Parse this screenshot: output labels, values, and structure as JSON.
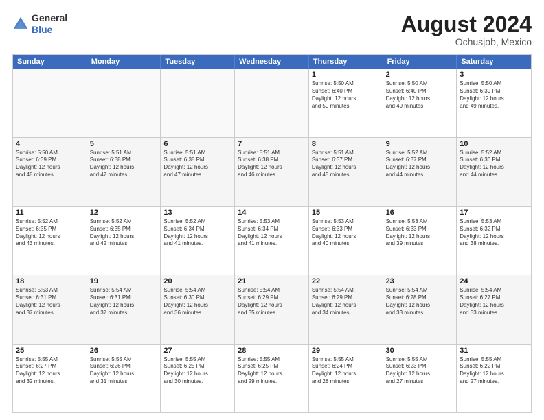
{
  "logo": {
    "text_general": "General",
    "text_blue": "Blue"
  },
  "header": {
    "month": "August 2024",
    "location": "Ochusjob, Mexico"
  },
  "weekdays": [
    "Sunday",
    "Monday",
    "Tuesday",
    "Wednesday",
    "Thursday",
    "Friday",
    "Saturday"
  ],
  "rows": [
    [
      {
        "day": "",
        "info": "",
        "empty": true
      },
      {
        "day": "",
        "info": "",
        "empty": true
      },
      {
        "day": "",
        "info": "",
        "empty": true
      },
      {
        "day": "",
        "info": "",
        "empty": true
      },
      {
        "day": "1",
        "info": "Sunrise: 5:50 AM\nSunset: 6:40 PM\nDaylight: 12 hours\nand 50 minutes.",
        "empty": false
      },
      {
        "day": "2",
        "info": "Sunrise: 5:50 AM\nSunset: 6:40 PM\nDaylight: 12 hours\nand 49 minutes.",
        "empty": false
      },
      {
        "day": "3",
        "info": "Sunrise: 5:50 AM\nSunset: 6:39 PM\nDaylight: 12 hours\nand 49 minutes.",
        "empty": false
      }
    ],
    [
      {
        "day": "4",
        "info": "Sunrise: 5:50 AM\nSunset: 6:39 PM\nDaylight: 12 hours\nand 48 minutes.",
        "empty": false
      },
      {
        "day": "5",
        "info": "Sunrise: 5:51 AM\nSunset: 6:38 PM\nDaylight: 12 hours\nand 47 minutes.",
        "empty": false
      },
      {
        "day": "6",
        "info": "Sunrise: 5:51 AM\nSunset: 6:38 PM\nDaylight: 12 hours\nand 47 minutes.",
        "empty": false
      },
      {
        "day": "7",
        "info": "Sunrise: 5:51 AM\nSunset: 6:38 PM\nDaylight: 12 hours\nand 46 minutes.",
        "empty": false
      },
      {
        "day": "8",
        "info": "Sunrise: 5:51 AM\nSunset: 6:37 PM\nDaylight: 12 hours\nand 45 minutes.",
        "empty": false
      },
      {
        "day": "9",
        "info": "Sunrise: 5:52 AM\nSunset: 6:37 PM\nDaylight: 12 hours\nand 44 minutes.",
        "empty": false
      },
      {
        "day": "10",
        "info": "Sunrise: 5:52 AM\nSunset: 6:36 PM\nDaylight: 12 hours\nand 44 minutes.",
        "empty": false
      }
    ],
    [
      {
        "day": "11",
        "info": "Sunrise: 5:52 AM\nSunset: 6:35 PM\nDaylight: 12 hours\nand 43 minutes.",
        "empty": false
      },
      {
        "day": "12",
        "info": "Sunrise: 5:52 AM\nSunset: 6:35 PM\nDaylight: 12 hours\nand 42 minutes.",
        "empty": false
      },
      {
        "day": "13",
        "info": "Sunrise: 5:52 AM\nSunset: 6:34 PM\nDaylight: 12 hours\nand 41 minutes.",
        "empty": false
      },
      {
        "day": "14",
        "info": "Sunrise: 5:53 AM\nSunset: 6:34 PM\nDaylight: 12 hours\nand 41 minutes.",
        "empty": false
      },
      {
        "day": "15",
        "info": "Sunrise: 5:53 AM\nSunset: 6:33 PM\nDaylight: 12 hours\nand 40 minutes.",
        "empty": false
      },
      {
        "day": "16",
        "info": "Sunrise: 5:53 AM\nSunset: 6:33 PM\nDaylight: 12 hours\nand 39 minutes.",
        "empty": false
      },
      {
        "day": "17",
        "info": "Sunrise: 5:53 AM\nSunset: 6:32 PM\nDaylight: 12 hours\nand 38 minutes.",
        "empty": false
      }
    ],
    [
      {
        "day": "18",
        "info": "Sunrise: 5:53 AM\nSunset: 6:31 PM\nDaylight: 12 hours\nand 37 minutes.",
        "empty": false
      },
      {
        "day": "19",
        "info": "Sunrise: 5:54 AM\nSunset: 6:31 PM\nDaylight: 12 hours\nand 37 minutes.",
        "empty": false
      },
      {
        "day": "20",
        "info": "Sunrise: 5:54 AM\nSunset: 6:30 PM\nDaylight: 12 hours\nand 36 minutes.",
        "empty": false
      },
      {
        "day": "21",
        "info": "Sunrise: 5:54 AM\nSunset: 6:29 PM\nDaylight: 12 hours\nand 35 minutes.",
        "empty": false
      },
      {
        "day": "22",
        "info": "Sunrise: 5:54 AM\nSunset: 6:29 PM\nDaylight: 12 hours\nand 34 minutes.",
        "empty": false
      },
      {
        "day": "23",
        "info": "Sunrise: 5:54 AM\nSunset: 6:28 PM\nDaylight: 12 hours\nand 33 minutes.",
        "empty": false
      },
      {
        "day": "24",
        "info": "Sunrise: 5:54 AM\nSunset: 6:27 PM\nDaylight: 12 hours\nand 33 minutes.",
        "empty": false
      }
    ],
    [
      {
        "day": "25",
        "info": "Sunrise: 5:55 AM\nSunset: 6:27 PM\nDaylight: 12 hours\nand 32 minutes.",
        "empty": false
      },
      {
        "day": "26",
        "info": "Sunrise: 5:55 AM\nSunset: 6:26 PM\nDaylight: 12 hours\nand 31 minutes.",
        "empty": false
      },
      {
        "day": "27",
        "info": "Sunrise: 5:55 AM\nSunset: 6:25 PM\nDaylight: 12 hours\nand 30 minutes.",
        "empty": false
      },
      {
        "day": "28",
        "info": "Sunrise: 5:55 AM\nSunset: 6:25 PM\nDaylight: 12 hours\nand 29 minutes.",
        "empty": false
      },
      {
        "day": "29",
        "info": "Sunrise: 5:55 AM\nSunset: 6:24 PM\nDaylight: 12 hours\nand 28 minutes.",
        "empty": false
      },
      {
        "day": "30",
        "info": "Sunrise: 5:55 AM\nSunset: 6:23 PM\nDaylight: 12 hours\nand 27 minutes.",
        "empty": false
      },
      {
        "day": "31",
        "info": "Sunrise: 5:55 AM\nSunset: 6:22 PM\nDaylight: 12 hours\nand 27 minutes.",
        "empty": false
      }
    ]
  ]
}
